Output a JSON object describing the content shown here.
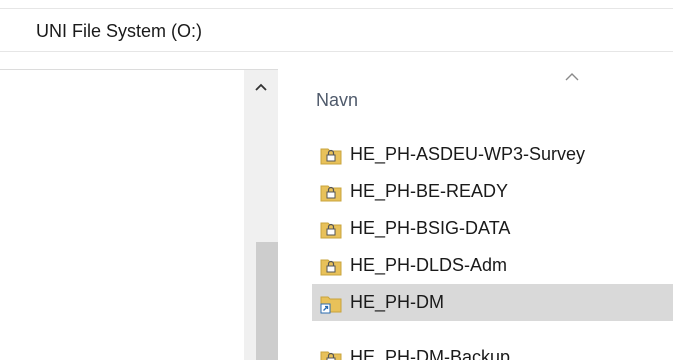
{
  "address": {
    "path": "UNI File System (O:)"
  },
  "column_header": {
    "name": "Navn"
  },
  "files": [
    {
      "name": "HE_PH-ASDEU-WP3-Survey",
      "icon": "locked-folder-icon",
      "selected": false
    },
    {
      "name": "HE_PH-BE-READY",
      "icon": "locked-folder-icon",
      "selected": false
    },
    {
      "name": "HE_PH-BSIG-DATA",
      "icon": "locked-folder-icon",
      "selected": false
    },
    {
      "name": "HE_PH-DLDS-Adm",
      "icon": "locked-folder-icon",
      "selected": false
    },
    {
      "name": "HE_PH-DM",
      "icon": "shortcut-folder-icon",
      "selected": true
    },
    {
      "name": "HE_PH-DM-Backup",
      "icon": "locked-folder-icon",
      "selected": false
    }
  ],
  "colors": {
    "selection": "#d9d9d9",
    "folder": "#e8c15a",
    "header_text": "#4f5a6b"
  }
}
